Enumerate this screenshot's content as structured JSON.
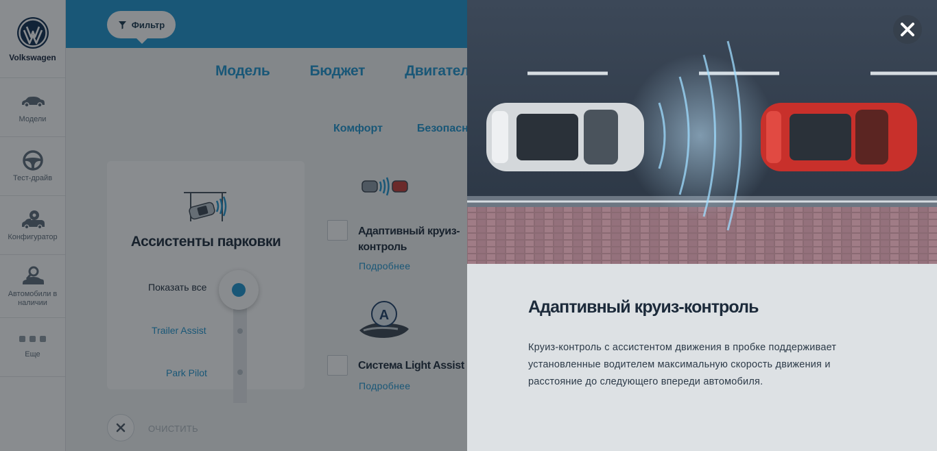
{
  "brand": {
    "name": "Volkswagen",
    "logo_icon": "vw-logo-icon"
  },
  "sidebar": {
    "items": [
      {
        "label": "Модели",
        "icon": "car-icon"
      },
      {
        "label": "Тест-драйв",
        "icon": "steering-wheel-icon"
      },
      {
        "label": "Конфигуратор",
        "icon": "car-gear-icon"
      },
      {
        "label": "Автомобили в наличии",
        "icon": "car-key-icon"
      },
      {
        "label": "Еще",
        "icon": "more-dots-icon"
      }
    ]
  },
  "filter": {
    "label": "Фильтр",
    "icon": "filter-icon"
  },
  "categories": [
    "Модель",
    "Бюджет",
    "Двигатель"
  ],
  "subcategories": [
    "Комфорт",
    "Безопасность"
  ],
  "parking_card": {
    "title": "Ассистенты парковки",
    "show_all": "Показать все",
    "options": [
      "Trailer Assist",
      "Park Pilot"
    ]
  },
  "features": [
    {
      "title_line1": "Адаптивный круиз-",
      "title_line2": "контроль",
      "more": "Подробнее"
    },
    {
      "title_line1": "Система Light Assist",
      "title_line2": "",
      "more": "Подробнее"
    }
  ],
  "clear": {
    "label": "ОЧИСТИТЬ"
  },
  "modal": {
    "title": "Адаптивный круиз-контроль",
    "description": "Круиз-контроль с ассистентом движения в пробке поддерживает установленные водителем максимальную скорость движения и расстояние до следующего впереди автомобиля."
  },
  "colors": {
    "accent": "#1e94cf",
    "dark_text": "#1c2a3a",
    "modal_bg": "#dde1e4"
  }
}
